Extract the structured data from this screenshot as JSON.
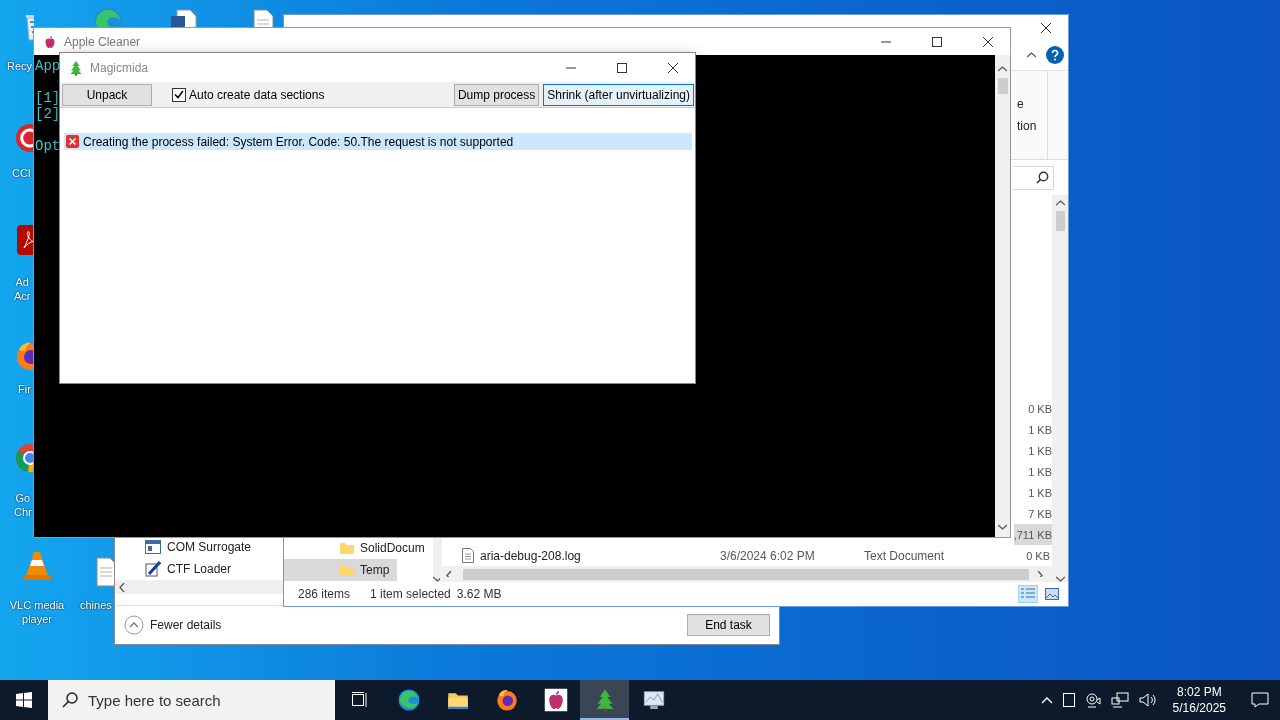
{
  "desktop": {
    "icons": [
      {
        "kind": "recycle",
        "label": [
          "Recy"
        ]
      },
      {
        "kind": "edge"
      },
      {
        "kind": "word"
      },
      {
        "kind": "file"
      },
      {
        "kind": "ccleaner",
        "label": [
          "CCl"
        ]
      },
      {
        "kind": "acrobat",
        "label": [
          "Ad",
          "Acr"
        ]
      },
      {
        "kind": "firefox",
        "label": [
          "Fir"
        ]
      },
      {
        "kind": "chrome",
        "label": [
          "Go",
          "Chr"
        ]
      },
      {
        "kind": "vlc",
        "label": [
          "VLC media",
          "player"
        ]
      },
      {
        "kind": "file",
        "label": [
          "chines"
        ]
      }
    ]
  },
  "explorer": {
    "ribbon_texts": [
      "e",
      "tion"
    ],
    "nav_items": [
      {
        "label": "SolidDocum",
        "selected": false
      },
      {
        "label": "Temp",
        "selected": true
      }
    ],
    "files": [
      {
        "size": "0 KB",
        "selected": false
      },
      {
        "size": "1 KB",
        "selected": false
      },
      {
        "size": "1 KB",
        "selected": false
      },
      {
        "size": "1 KB",
        "selected": false
      },
      {
        "size": "1 KB",
        "selected": false
      },
      {
        "size": "7 KB",
        "selected": false
      },
      {
        "size": ",711 KB",
        "selected": true
      },
      {
        "name": "aria-debug-208.log",
        "date": "3/6/2024 6:02 PM",
        "type": "Text Document",
        "size": "0 KB",
        "selected": false
      }
    ],
    "status": {
      "count": "286 items",
      "selection": "1 item selected",
      "size": "3.62 MB"
    }
  },
  "task_manager": {
    "processes": [
      {
        "name": "COM Surrogate",
        "kind": "surrogate"
      },
      {
        "name": "CTF Loader",
        "kind": "ctf"
      }
    ],
    "fewer_details": "Fewer details",
    "end_task": "End task"
  },
  "console": {
    "title": "Apple Cleaner",
    "lines": [
      "App",
      "[1]",
      "[2]",
      "Opt"
    ]
  },
  "magicmida": {
    "title": "Magicmida",
    "buttons": [
      {
        "label": "Unpack",
        "focused": false
      },
      {
        "label": "Dump process",
        "focused": false
      },
      {
        "label": "Shrink (after unvirtualizing)",
        "focused": true
      }
    ],
    "checkbox": {
      "label": "Auto create data sections",
      "checked": true
    },
    "log": [
      {
        "text": "Creating the process failed: System Error.  Code: 50.The request is not supported",
        "kind": "error",
        "selected": true
      }
    ]
  },
  "taskbar": {
    "search_placeholder": "Type here to search",
    "apps": [
      {
        "kind": "edge",
        "selected": false
      },
      {
        "kind": "folder",
        "selected": false
      },
      {
        "kind": "firefox",
        "selected": false
      },
      {
        "kind": "apple",
        "selected": false
      },
      {
        "kind": "tree",
        "selected": true
      },
      {
        "kind": "monitor",
        "selected": false
      }
    ],
    "time": "8:02 PM",
    "date": "5/16/2025"
  }
}
